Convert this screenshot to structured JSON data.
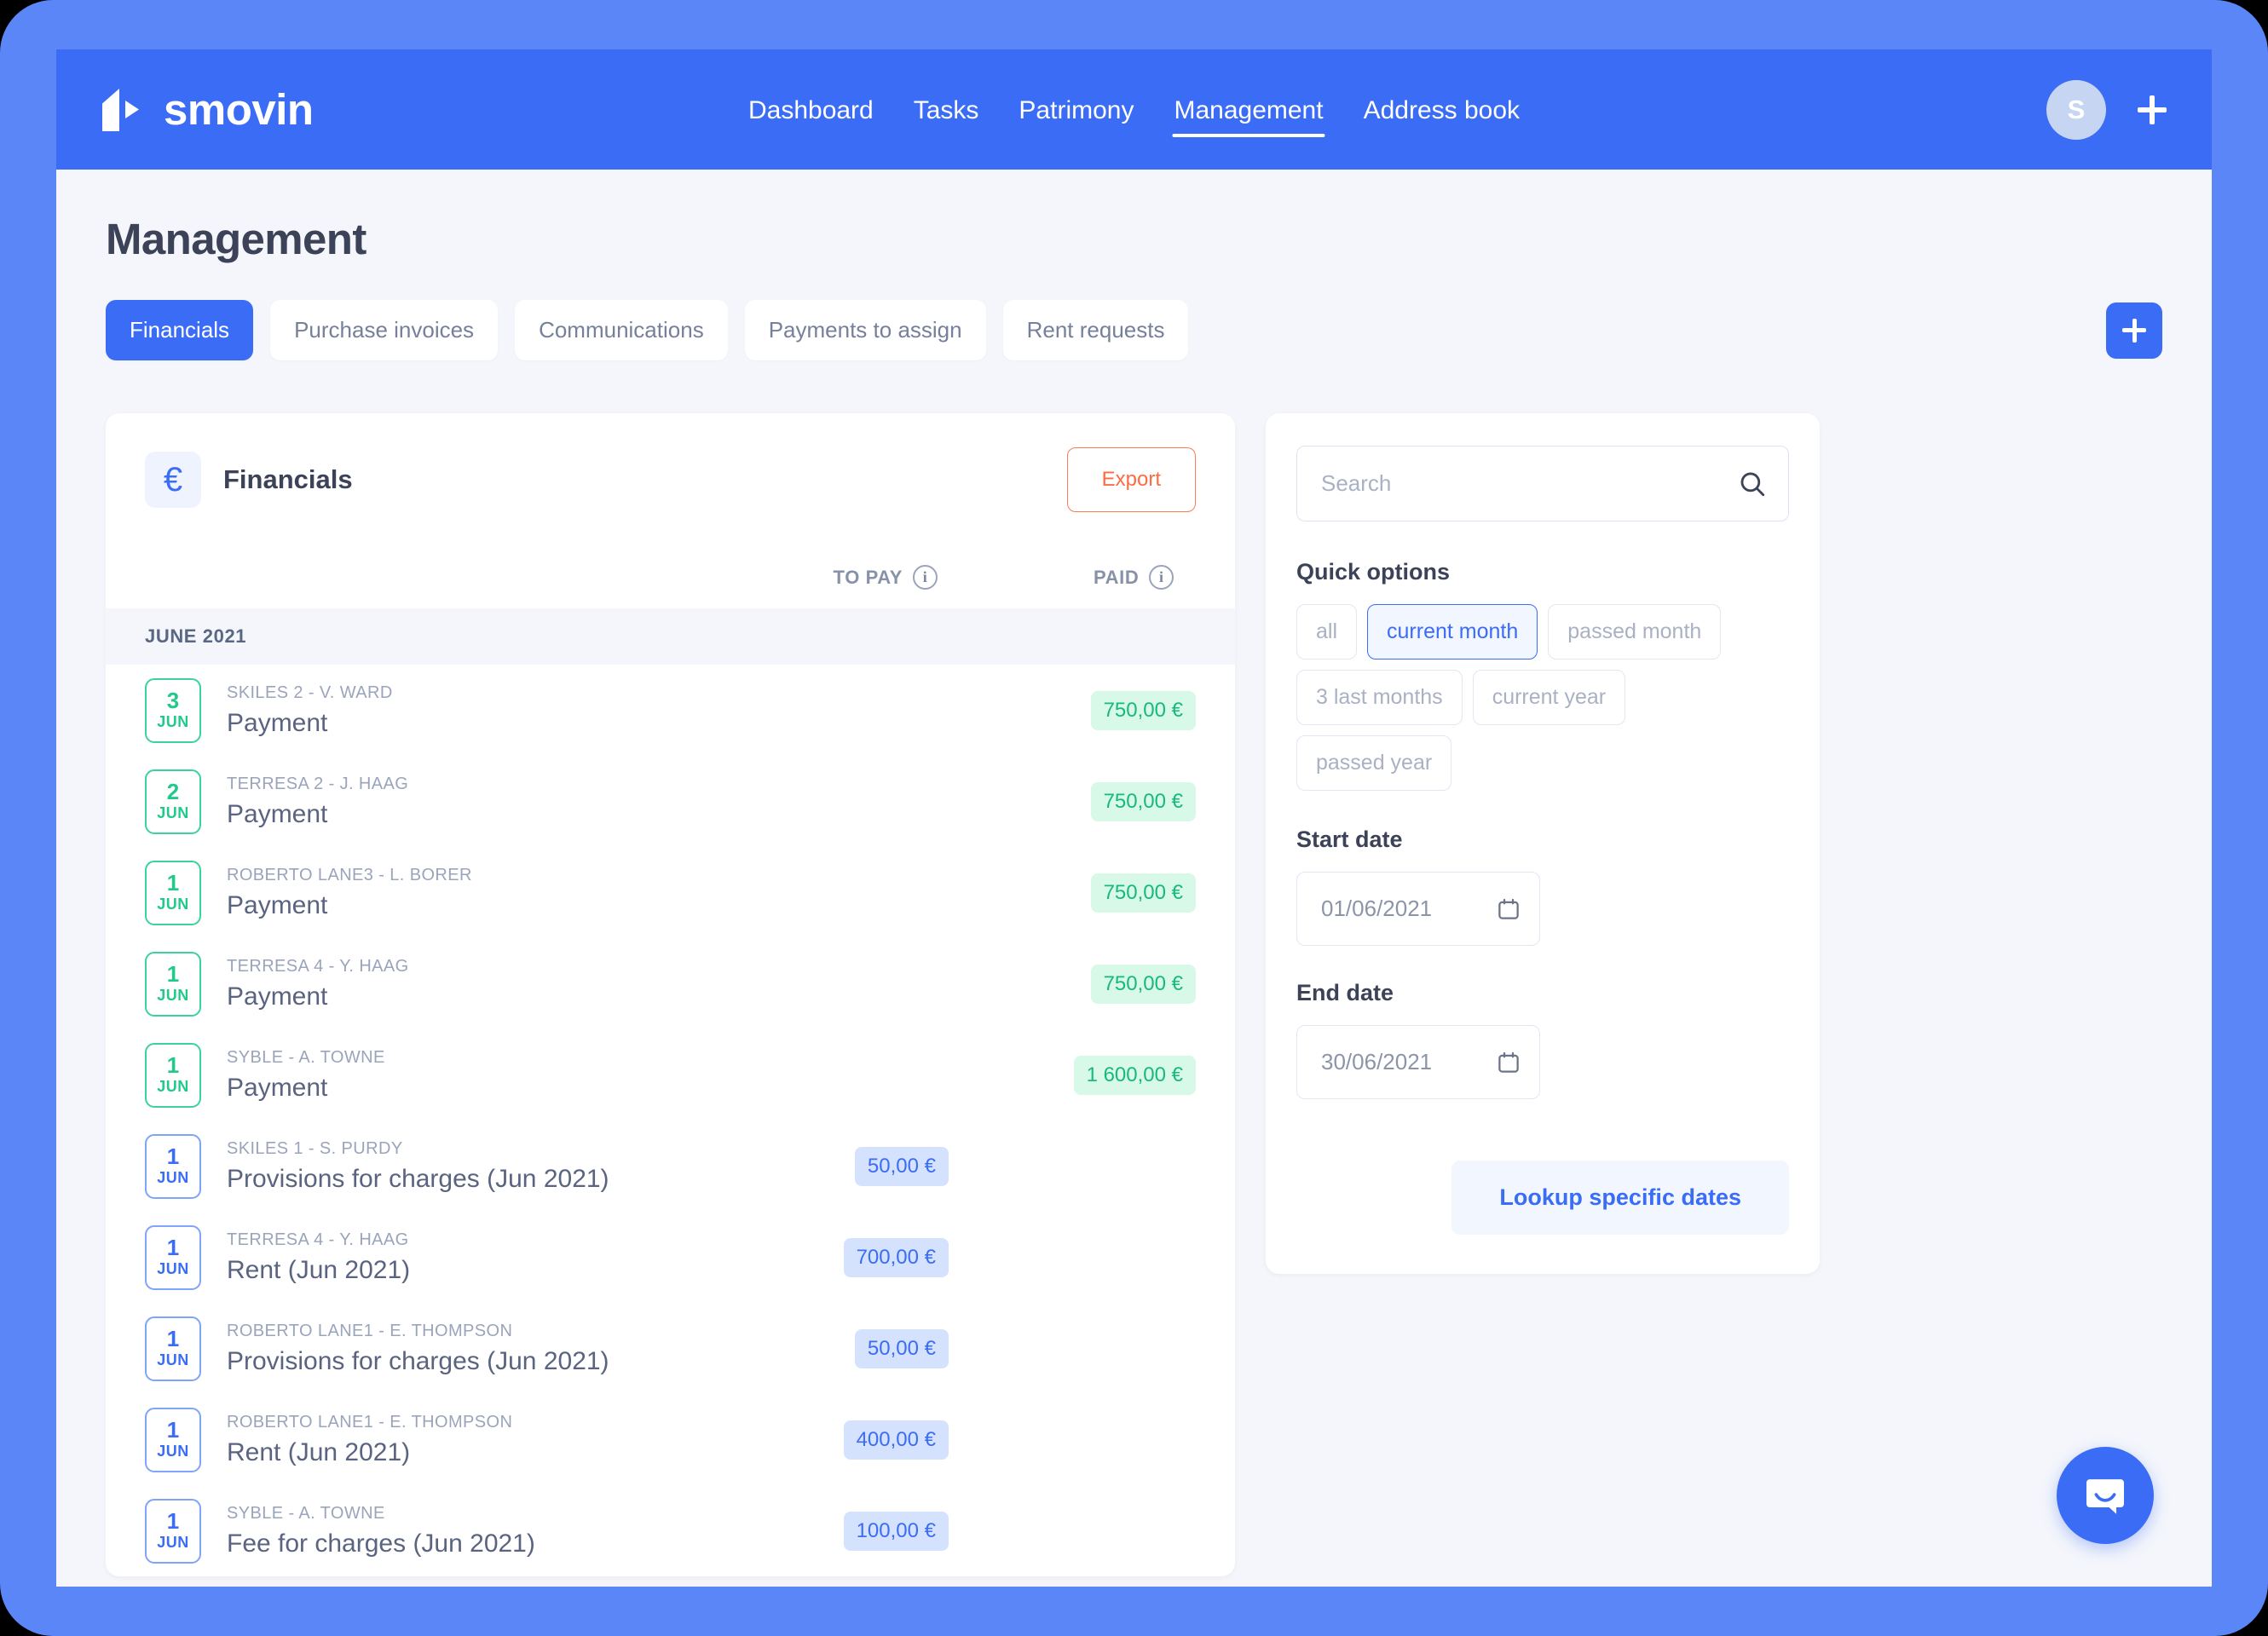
{
  "brand": {
    "name": "smovin",
    "logo_icon": "smovin-logo-icon"
  },
  "nav": {
    "links": [
      {
        "label": "Dashboard",
        "active": false
      },
      {
        "label": "Tasks",
        "active": false
      },
      {
        "label": "Patrimony",
        "active": false
      },
      {
        "label": "Management",
        "active": true
      },
      {
        "label": "Address book",
        "active": false
      }
    ],
    "avatar_initial": "S",
    "add_icon": "plus-icon"
  },
  "page": {
    "title": "Management"
  },
  "tabs": [
    {
      "label": "Financials",
      "active": true
    },
    {
      "label": "Purchase invoices",
      "active": false
    },
    {
      "label": "Communications",
      "active": false
    },
    {
      "label": "Payments to assign",
      "active": false
    },
    {
      "label": "Rent requests",
      "active": false
    }
  ],
  "tab_add_icon": "plus-icon",
  "financials": {
    "icon": "euro-icon",
    "icon_glyph": "€",
    "title": "Financials",
    "export_label": "Export",
    "columns": {
      "to_pay": "TO PAY",
      "paid": "PAID",
      "info_icon": "info-icon"
    },
    "month_label": "JUNE 2021",
    "rows": [
      {
        "day": "3",
        "month": "JUN",
        "sub": "SKILES 2 - V. WARD",
        "label": "Payment",
        "amount": "750,00 €",
        "state": "paid"
      },
      {
        "day": "2",
        "month": "JUN",
        "sub": "TERRESA 2 - J. HAAG",
        "label": "Payment",
        "amount": "750,00 €",
        "state": "paid"
      },
      {
        "day": "1",
        "month": "JUN",
        "sub": "ROBERTO LANE3 - L. BORER",
        "label": "Payment",
        "amount": "750,00 €",
        "state": "paid"
      },
      {
        "day": "1",
        "month": "JUN",
        "sub": "TERRESA 4 - Y. HAAG",
        "label": "Payment",
        "amount": "750,00 €",
        "state": "paid"
      },
      {
        "day": "1",
        "month": "JUN",
        "sub": "SYBLE - A. TOWNE",
        "label": "Payment",
        "amount": "1 600,00 €",
        "state": "paid"
      },
      {
        "day": "1",
        "month": "JUN",
        "sub": "SKILES 1 - S. PURDY",
        "label": "Provisions for charges (Jun 2021)",
        "amount": "50,00 €",
        "state": "topay"
      },
      {
        "day": "1",
        "month": "JUN",
        "sub": "TERRESA 4 - Y. HAAG",
        "label": "Rent (Jun 2021)",
        "amount": "700,00 €",
        "state": "topay"
      },
      {
        "day": "1",
        "month": "JUN",
        "sub": "ROBERTO LANE1 - E. THOMPSON",
        "label": "Provisions for charges (Jun 2021)",
        "amount": "50,00 €",
        "state": "topay"
      },
      {
        "day": "1",
        "month": "JUN",
        "sub": "ROBERTO LANE1 - E. THOMPSON",
        "label": "Rent (Jun 2021)",
        "amount": "400,00 €",
        "state": "topay"
      },
      {
        "day": "1",
        "month": "JUN",
        "sub": "SYBLE - A. TOWNE",
        "label": "Fee for charges (Jun 2021)",
        "amount": "100,00 €",
        "state": "topay"
      }
    ]
  },
  "filters": {
    "search": {
      "placeholder": "Search",
      "value": "",
      "icon": "search-icon"
    },
    "quick_options_label": "Quick options",
    "quick_options": [
      {
        "label": "all",
        "active": false
      },
      {
        "label": "current month",
        "active": true
      },
      {
        "label": "passed month",
        "active": false
      },
      {
        "label": "3 last months",
        "active": false
      },
      {
        "label": "current year",
        "active": false
      },
      {
        "label": "passed year",
        "active": false
      }
    ],
    "start_date": {
      "label": "Start date",
      "value": "01/06/2021",
      "icon": "calendar-icon"
    },
    "end_date": {
      "label": "End date",
      "value": "30/06/2021",
      "icon": "calendar-icon"
    },
    "lookup_label": "Lookup specific dates"
  },
  "intercom": {
    "icon": "chat-bubble-icon"
  },
  "colors": {
    "brand_blue": "#3B6CF5",
    "frame_blue": "#5B86F7",
    "paid_green": "#17B97D",
    "paid_green_bg": "#D8F8E8",
    "topay_blue_bg": "#D5E2FD",
    "export_orange": "#FF6B42",
    "page_bg": "#F4F6FB"
  }
}
